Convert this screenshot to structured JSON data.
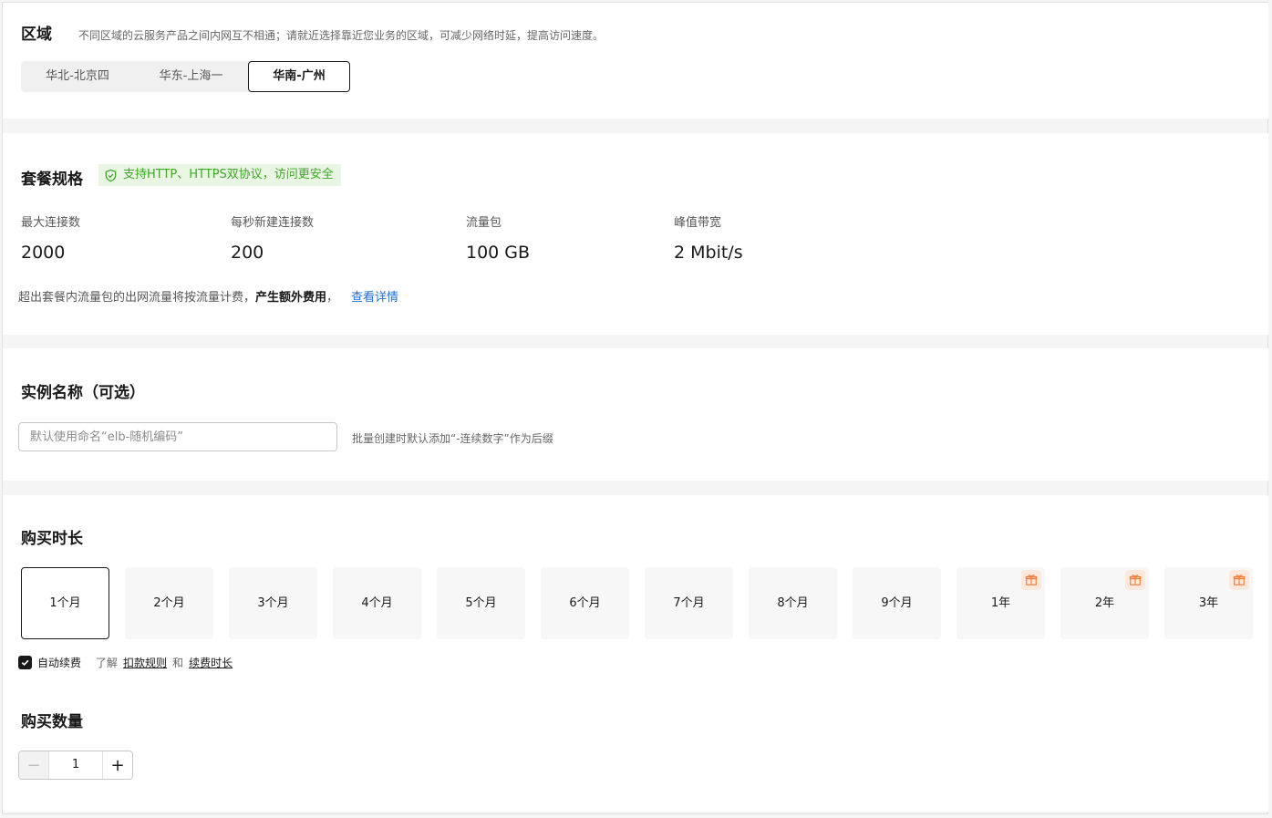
{
  "region": {
    "title": "区域",
    "description": "不同区域的云服务产品之间内网互不相通；请就近选择靠近您业务的区域，可减少网络时延，提高访问速度。",
    "options": [
      "华北-北京四",
      "华东-上海一",
      "华南-广州"
    ],
    "selected": "华南-广州"
  },
  "package": {
    "title": "套餐规格",
    "badge": "支持HTTP、HTTPS双协议，访问更安全",
    "specs": [
      {
        "label": "最大连接数",
        "value": "2000"
      },
      {
        "label": "每秒新建连接数",
        "value": "200"
      },
      {
        "label": "流量包",
        "value": "100 GB"
      },
      {
        "label": "峰值带宽",
        "value": "2 Mbit/s"
      }
    ],
    "note_prefix": "超出套餐内流量包的出网流量将按流量计费，",
    "note_bold": "产生额外费用",
    "note_suffix": "，",
    "note_link": "查看详情"
  },
  "instance_name": {
    "title": "实例名称（可选）",
    "placeholder": "默认使用命名“elb-随机编码”",
    "hint": "批量创建时默认添加“-连续数字”作为后缀"
  },
  "duration": {
    "title": "购买时长",
    "options": [
      "1个月",
      "2个月",
      "3个月",
      "4个月",
      "5个月",
      "6个月",
      "7个月",
      "8个月",
      "9个月",
      "1年",
      "2年",
      "3年"
    ],
    "selected": "1个月",
    "gift_options": [
      "1年",
      "2年",
      "3年"
    ],
    "auto_renew_label": "自动续费",
    "auto_renew_checked": true,
    "learn_text": "了解",
    "link_rules": "扣款规则",
    "and_text": "和",
    "link_duration": "续费时长"
  },
  "quantity": {
    "title": "购买数量",
    "value": "1",
    "minus": "−",
    "plus": "+"
  },
  "colors": {
    "accent_link": "#1f6fd6",
    "badge_green": "#3da826",
    "badge_bg": "#e8f6e3",
    "gift_orange": "#f07c3a"
  }
}
